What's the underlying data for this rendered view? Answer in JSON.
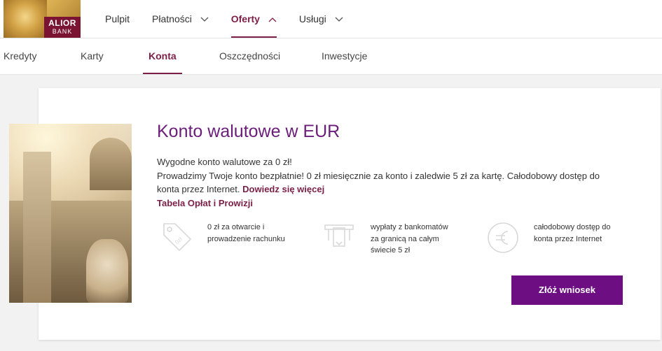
{
  "brand": {
    "line1": "ALIOR",
    "line2": "BANK"
  },
  "main_nav": [
    {
      "label": "Pulpit",
      "has_chevron": false
    },
    {
      "label": "Płatności",
      "has_chevron": true
    },
    {
      "label": "Oferty",
      "has_chevron": true,
      "active": true
    },
    {
      "label": "Usługi",
      "has_chevron": true
    }
  ],
  "sub_nav": [
    {
      "label": "Kredyty"
    },
    {
      "label": "Karty"
    },
    {
      "label": "Konta",
      "active": true
    },
    {
      "label": "Oszczędności"
    },
    {
      "label": "Inwestycje"
    }
  ],
  "offer": {
    "title": "Konto walutowe w EUR",
    "line1": "Wygodne konto walutowe za 0 zł!",
    "line2": "Prowadzimy Twoje konto bezpłatnie! 0 zł miesięcznie za konto i zaledwie 5 zł za kartę. Całodobowy dostęp do konta przez Internet.",
    "more_link": "Dowiedz się więcej",
    "fees_link": "Tabela Opłat i Prowizji",
    "features": [
      {
        "icon": "price-tag-icon",
        "line1": "0 zł za otwarcie i",
        "line2": "prowadzenie rachunku"
      },
      {
        "icon": "atm-icon",
        "line1": "wypłaty z bankomatów",
        "line2": "za granicą na całym",
        "line3": "świecie 5 zł"
      },
      {
        "icon": "euro-coin-icon",
        "line1": "całodobowy dostęp do",
        "line2": "konta przez Internet"
      }
    ],
    "cta_label": "Złóż wniosek"
  },
  "colors": {
    "accent": "#7b1f46",
    "title": "#6b1d7a",
    "button": "#6d0f83",
    "logo_bg": "#7b1432"
  }
}
